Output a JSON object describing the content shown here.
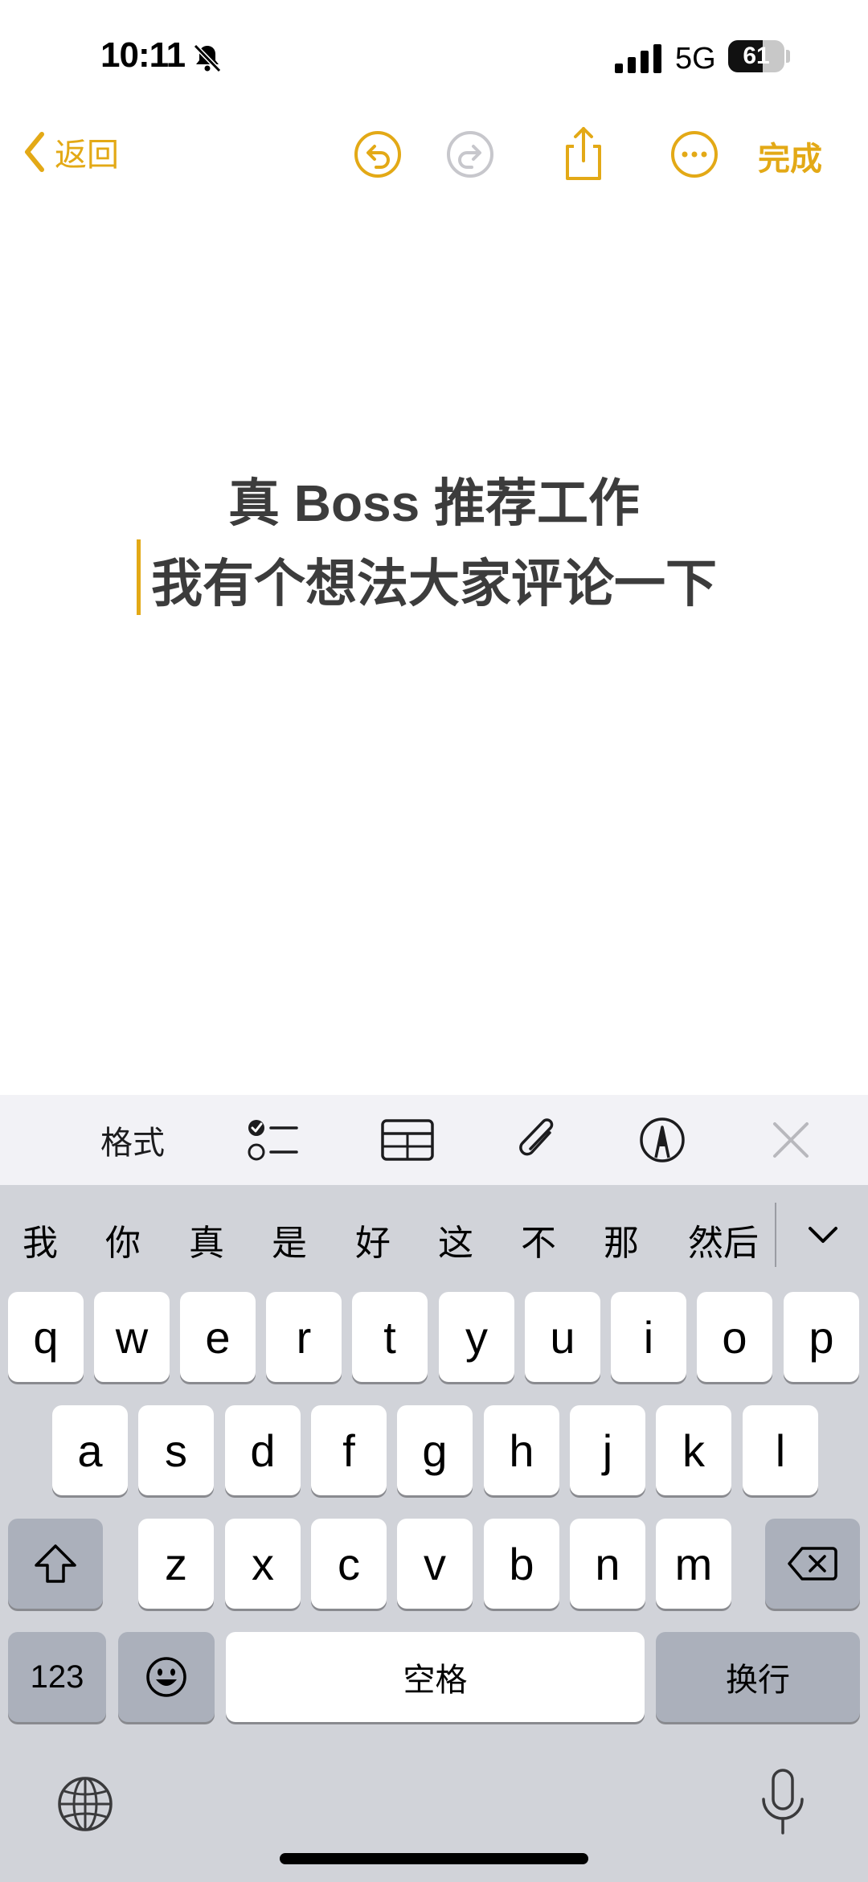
{
  "status_bar": {
    "time": "10:11",
    "network": "5G",
    "battery_level": "61",
    "battery_fraction": 0.61
  },
  "nav": {
    "back_label": "返回",
    "done_label": "完成",
    "accent_color": "#e3a916",
    "icons": [
      "undo-icon",
      "redo-icon",
      "share-icon",
      "more-icon"
    ]
  },
  "note": {
    "line1": "真 Boss 推荐工作",
    "line2": "我有个想法大家评论一下"
  },
  "toolbar": {
    "format_label": "格式",
    "icons": [
      "checklist-icon",
      "table-icon",
      "attachment-icon",
      "markup-icon",
      "close-icon"
    ]
  },
  "keyboard": {
    "candidates": [
      "我",
      "你",
      "真",
      "是",
      "好",
      "这",
      "不",
      "那",
      "然后"
    ],
    "row1": [
      "q",
      "w",
      "e",
      "r",
      "t",
      "y",
      "u",
      "i",
      "o",
      "p"
    ],
    "row2": [
      "a",
      "s",
      "d",
      "f",
      "g",
      "h",
      "j",
      "k",
      "l"
    ],
    "row3": [
      "z",
      "x",
      "c",
      "v",
      "b",
      "n",
      "m"
    ],
    "numbers_label": "123",
    "space_label": "空格",
    "return_label": "换行"
  }
}
